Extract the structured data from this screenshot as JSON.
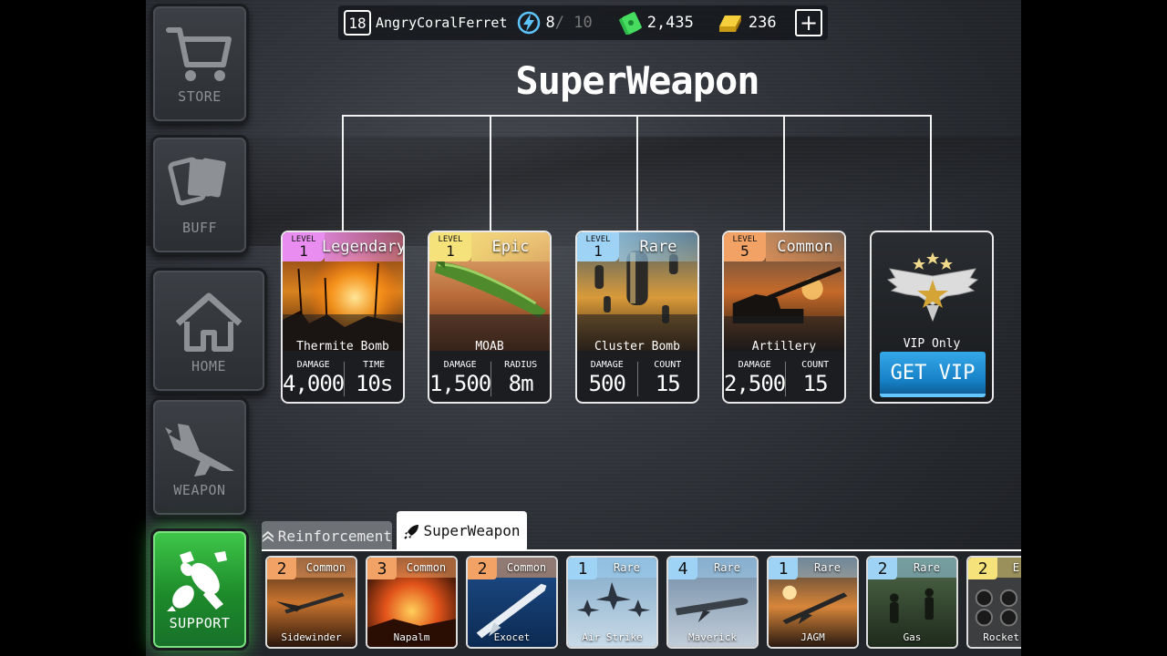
{
  "colors": {
    "legendary": "#e98ef0",
    "epic": "#f5e27a",
    "rare": "#9fd3f5",
    "common": "#f2a265",
    "accent_green": "#37c44a",
    "vip_blue": "#1f8fd8"
  },
  "nav": [
    {
      "label": "STORE",
      "icon": "cart-icon",
      "active": false
    },
    {
      "label": "BUFF",
      "icon": "cards-icon",
      "active": false
    },
    {
      "label": "HOME",
      "icon": "home-icon",
      "active": false
    },
    {
      "label": "WEAPON",
      "icon": "jet-icon",
      "active": false
    },
    {
      "label": "SUPPORT",
      "icon": "bombs-icon",
      "active": true
    }
  ],
  "player": {
    "level": "18",
    "name": "AngryCoralFerret",
    "energy": "8",
    "energy_max": "/ 10",
    "cash": "2,435",
    "gold": "236"
  },
  "title": "SuperWeapon",
  "cards": [
    {
      "level_label": "LEVEL",
      "level": "1",
      "rarity": "Legendary",
      "name": "Thermite Bomb",
      "stat1_label": "DAMAGE",
      "stat1_value": "4,000",
      "stat2_label": "TIME",
      "stat2_value": "10s"
    },
    {
      "level_label": "LEVEL",
      "level": "1",
      "rarity": "Epic",
      "name": "MOAB",
      "stat1_label": "DAMAGE",
      "stat1_value": "1,500",
      "stat2_label": "RADIUS",
      "stat2_value": "8m"
    },
    {
      "level_label": "LEVEL",
      "level": "1",
      "rarity": "Rare",
      "name": "Cluster Bomb",
      "stat1_label": "DAMAGE",
      "stat1_value": "500",
      "stat2_label": "COUNT",
      "stat2_value": "15"
    },
    {
      "level_label": "LEVEL",
      "level": "5",
      "rarity": "Common",
      "name": "Artillery",
      "stat1_label": "DAMAGE",
      "stat1_value": "2,500",
      "stat2_label": "COUNT",
      "stat2_value": "15"
    }
  ],
  "vip": {
    "text": "VIP Only",
    "button": "GET VIP"
  },
  "tabs": {
    "reinforcement": "Reinforcement",
    "superweapon": "SuperWeapon"
  },
  "items": [
    {
      "level": "2",
      "rarity": "Common",
      "name": "Sidewinder"
    },
    {
      "level": "3",
      "rarity": "Common",
      "name": "Napalm"
    },
    {
      "level": "2",
      "rarity": "Common",
      "name": "Exocet"
    },
    {
      "level": "1",
      "rarity": "Rare",
      "name": "Air Strike"
    },
    {
      "level": "4",
      "rarity": "Rare",
      "name": "Maverick"
    },
    {
      "level": "1",
      "rarity": "Rare",
      "name": "JAGM"
    },
    {
      "level": "2",
      "rarity": "Rare",
      "name": "Gas"
    },
    {
      "level": "2",
      "rarity": "E",
      "name": "Rocket"
    }
  ]
}
